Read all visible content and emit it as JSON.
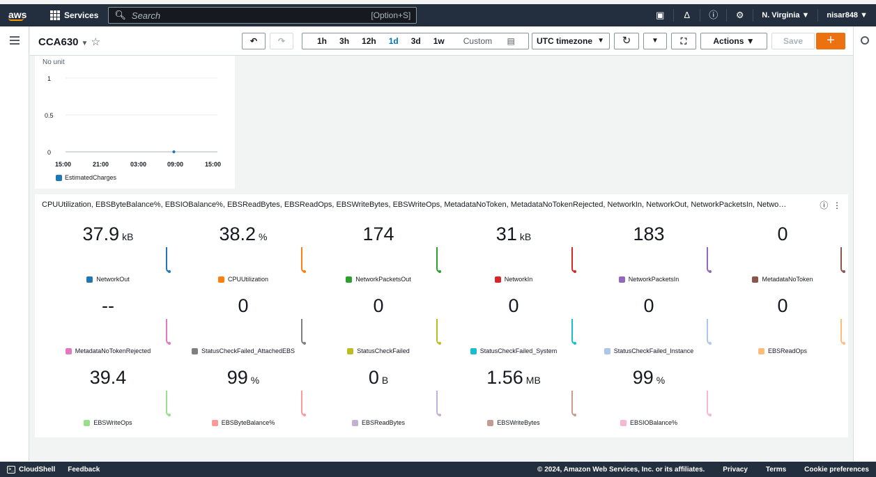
{
  "nav": {
    "logo": "aws",
    "services": "Services",
    "search_placeholder": "Search",
    "search_shortcut": "[Option+S]",
    "region": "N. Virginia ▼",
    "user": "nisar848 ▼"
  },
  "dashboard": {
    "title": "CCA630",
    "range_options": [
      "1h",
      "3h",
      "12h",
      "1d",
      "3d",
      "1w"
    ],
    "active_range": "1d",
    "custom": "Custom",
    "timezone": "UTC timezone",
    "actions": "Actions ▼",
    "save": "Save"
  },
  "widget_charges": {
    "unit_label": "No unit",
    "y_ticks": [
      "1",
      "0.5",
      "0"
    ],
    "x_ticks": [
      "15:00",
      "21:00",
      "03:00",
      "09:00",
      "15:00"
    ],
    "legend": "EstimatedCharges",
    "color": "#1f77b4"
  },
  "chart_data": {
    "type": "line",
    "x": [
      "15:00",
      "21:00",
      "03:00",
      "09:00",
      "15:00"
    ],
    "series": [
      {
        "name": "EstimatedCharges",
        "values": [
          null,
          null,
          null,
          0,
          null
        ]
      }
    ],
    "ylim": [
      0,
      1
    ]
  },
  "widget_metrics": {
    "title": "CPUUtilization, EBSByteBalance%, EBSIOBalance%, EBSReadBytes, EBSReadOps, EBSWriteBytes, EBSWriteOps, MetadataNoToken, MetadataNoTokenRejected, NetworkIn, NetworkOut, NetworkPacketsIn, Netwo…",
    "cells": [
      {
        "value": "37.9",
        "unit": "kB",
        "label": "NetworkOut",
        "color": "#1f77b4"
      },
      {
        "value": "38.2",
        "unit": "%",
        "label": "CPUUtilization",
        "color": "#ff7f0e"
      },
      {
        "value": "174",
        "unit": "",
        "label": "NetworkPacketsOut",
        "color": "#2ca02c"
      },
      {
        "value": "31",
        "unit": "kB",
        "label": "NetworkIn",
        "color": "#d62728"
      },
      {
        "value": "183",
        "unit": "",
        "label": "NetworkPacketsIn",
        "color": "#9467bd"
      },
      {
        "value": "0",
        "unit": "",
        "label": "MetadataNoToken",
        "color": "#8c564b"
      },
      {
        "value": "--",
        "unit": "",
        "label": "MetadataNoTokenRejected",
        "color": "#e377c2"
      },
      {
        "value": "0",
        "unit": "",
        "label": "StatusCheckFailed_AttachedEBS",
        "color": "#7f7f7f"
      },
      {
        "value": "0",
        "unit": "",
        "label": "StatusCheckFailed",
        "color": "#bcbd22"
      },
      {
        "value": "0",
        "unit": "",
        "label": "StatusCheckFailed_System",
        "color": "#17becf"
      },
      {
        "value": "0",
        "unit": "",
        "label": "StatusCheckFailed_Instance",
        "color": "#aec7e8"
      },
      {
        "value": "0",
        "unit": "",
        "label": "EBSReadOps",
        "color": "#ffbb78"
      },
      {
        "value": "39.4",
        "unit": "",
        "label": "EBSWriteOps",
        "color": "#98df8a"
      },
      {
        "value": "99",
        "unit": "%",
        "label": "EBSByteBalance%",
        "color": "#ff9896"
      },
      {
        "value": "0",
        "unit": "B",
        "label": "EBSReadBytes",
        "color": "#c5b0d5"
      },
      {
        "value": "1.56",
        "unit": "MB",
        "label": "EBSWriteBytes",
        "color": "#c49c94"
      },
      {
        "value": "99",
        "unit": "%",
        "label": "EBSIOBalance%",
        "color": "#f7b6d2"
      }
    ]
  },
  "footer": {
    "cloudshell": "CloudShell",
    "feedback": "Feedback",
    "copyright": "© 2024, Amazon Web Services, Inc. or its affiliates.",
    "privacy": "Privacy",
    "terms": "Terms",
    "cookies": "Cookie preferences"
  }
}
